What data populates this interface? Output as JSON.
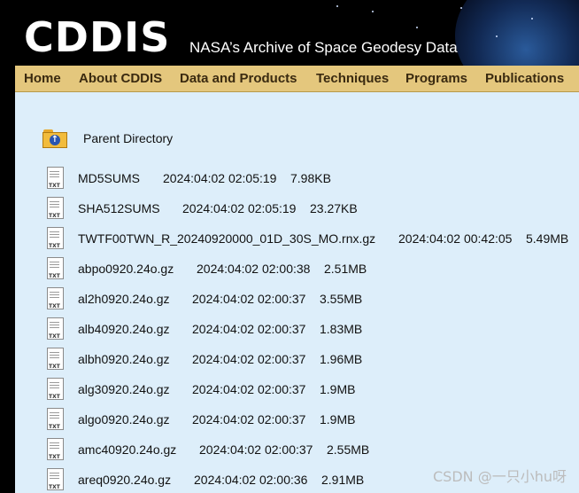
{
  "header": {
    "logo_text": "CDDIS",
    "tagline": "NASA’s Archive of Space Geodesy Data"
  },
  "nav": {
    "items": [
      {
        "label": "Home"
      },
      {
        "label": "About CDDIS"
      },
      {
        "label": "Data and Products"
      },
      {
        "label": "Techniques"
      },
      {
        "label": "Programs"
      },
      {
        "label": "Publications"
      }
    ]
  },
  "parent_directory": {
    "label": "Parent Directory",
    "icon": "folder-up-icon"
  },
  "files": [
    {
      "name": "MD5SUMS",
      "date": "2024:04:02 02:05:19",
      "size": "7.98KB",
      "icon": "txt-file-icon"
    },
    {
      "name": "SHA512SUMS",
      "date": "2024:04:02 02:05:19",
      "size": "23.27KB",
      "icon": "txt-file-icon"
    },
    {
      "name": "TWTF00TWN_R_20240920000_01D_30S_MO.rnx.gz",
      "date": "2024:04:02 00:42:05",
      "size": "5.49MB",
      "icon": "txt-file-icon"
    },
    {
      "name": "abpo0920.24o.gz",
      "date": "2024:04:02 02:00:38",
      "size": "2.51MB",
      "icon": "txt-file-icon"
    },
    {
      "name": "al2h0920.24o.gz",
      "date": "2024:04:02 02:00:37",
      "size": "3.55MB",
      "icon": "txt-file-icon"
    },
    {
      "name": "alb40920.24o.gz",
      "date": "2024:04:02 02:00:37",
      "size": "1.83MB",
      "icon": "txt-file-icon"
    },
    {
      "name": "albh0920.24o.gz",
      "date": "2024:04:02 02:00:37",
      "size": "1.96MB",
      "icon": "txt-file-icon"
    },
    {
      "name": "alg30920.24o.gz",
      "date": "2024:04:02 02:00:37",
      "size": "1.9MB",
      "icon": "txt-file-icon"
    },
    {
      "name": "algo0920.24o.gz",
      "date": "2024:04:02 02:00:37",
      "size": "1.9MB",
      "icon": "txt-file-icon"
    },
    {
      "name": "amc40920.24o.gz",
      "date": "2024:04:02 02:00:37",
      "size": "2.55MB",
      "icon": "txt-file-icon"
    },
    {
      "name": "areq0920.24o.gz",
      "date": "2024:04:02 02:00:36",
      "size": "2.91MB",
      "icon": "txt-file-icon"
    }
  ],
  "watermark": "CSDN @一只小hu呀",
  "colors": {
    "nav_bg": "#e4c77d",
    "content_bg": "#ddeefa",
    "header_bg": "#000000"
  }
}
